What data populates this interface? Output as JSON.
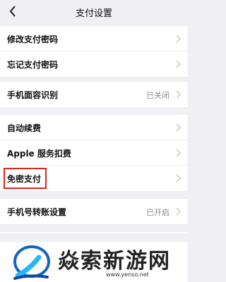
{
  "nav": {
    "title": "支付设置"
  },
  "groups": [
    {
      "items": [
        {
          "label": "修改支付密码",
          "value": ""
        },
        {
          "label": "忘记支付密码",
          "value": ""
        }
      ]
    },
    {
      "items": [
        {
          "label": "手机面容识别",
          "value": "已关闭"
        }
      ]
    },
    {
      "items": [
        {
          "label": "自动续费",
          "value": ""
        },
        {
          "label": "Apple 服务扣费",
          "value": ""
        },
        {
          "label": "免密支付",
          "value": ""
        }
      ]
    },
    {
      "items": [
        {
          "label": "手机号转账设置",
          "value": "已开启"
        }
      ]
    }
  ],
  "watermark": {
    "text": "焱索新游网",
    "url": "www.yenso.net"
  }
}
